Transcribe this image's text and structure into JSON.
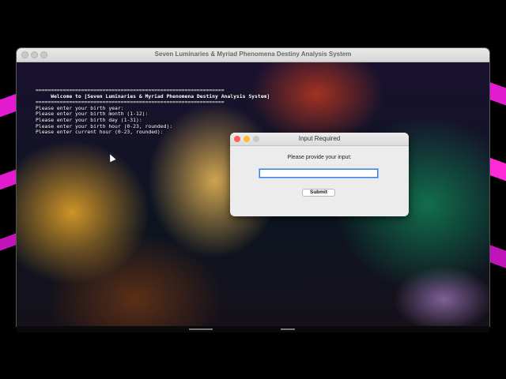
{
  "window": {
    "title": "Seven Luminaries & Myriad Phenomena Destiny Analysis System"
  },
  "terminal": {
    "lines": [
      "==============================================================",
      "     Welcome to [Seven Luminaries & Myriad Phenomena Destiny Analysis System]",
      "==============================================================",
      "Please enter your birth year:",
      "Please enter your birth month (1-12):",
      "Please enter your birth day (1-31):",
      "Please enter your birth hour (0-23, rounded):",
      "Please enter current hour (0-23, rounded):"
    ]
  },
  "dialog": {
    "title": "Input Required",
    "prompt": "Please provide your input:",
    "input_value": "",
    "submit_label": "Submit"
  },
  "colors": {
    "close": "#fe5f57",
    "minimize": "#febc2e",
    "inactive": "#c9c9c9",
    "accent": "#3d7fdc",
    "desktop_edge": "#e21bd0"
  },
  "icons": {
    "cursor": "arrow-cursor-icon"
  }
}
